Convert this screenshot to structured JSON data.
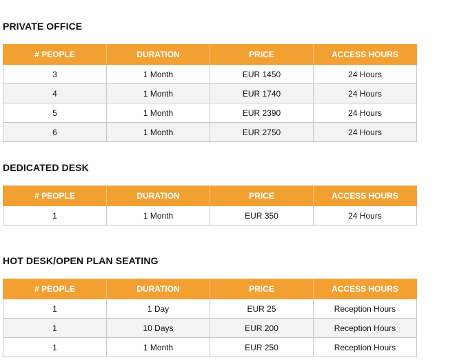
{
  "columns": [
    "# PEOPLE",
    "DURATION",
    "PRICE",
    "ACCESS HOURS"
  ],
  "sections": [
    {
      "title": "PRIVATE OFFICE",
      "rows": [
        [
          "3",
          "1 Month",
          "EUR 1450",
          "24 Hours"
        ],
        [
          "4",
          "1 Month",
          "EUR 1740",
          "24 Hours"
        ],
        [
          "5",
          "1 Month",
          "EUR 2390",
          "24 Hours"
        ],
        [
          "6",
          "1 Month",
          "EUR 2750",
          "24 Hours"
        ]
      ]
    },
    {
      "title": "DEDICATED DESK",
      "rows": [
        [
          "1",
          "1 Month",
          "EUR 350",
          "24 Hours"
        ]
      ]
    },
    {
      "title": "HOT DESK/OPEN PLAN SEATING",
      "rows": [
        [
          "1",
          "1 Day",
          "EUR 25",
          "Reception Hours"
        ],
        [
          "1",
          "10 Days",
          "EUR 200",
          "Reception Hours"
        ],
        [
          "1",
          "1 Month",
          "EUR 250",
          "Reception Hours"
        ]
      ]
    }
  ],
  "colors": {
    "header_bg": "#f3a033",
    "header_text": "#ffffff",
    "alt_row_bg": "#f3f3f3",
    "border": "#c8c8c8"
  }
}
